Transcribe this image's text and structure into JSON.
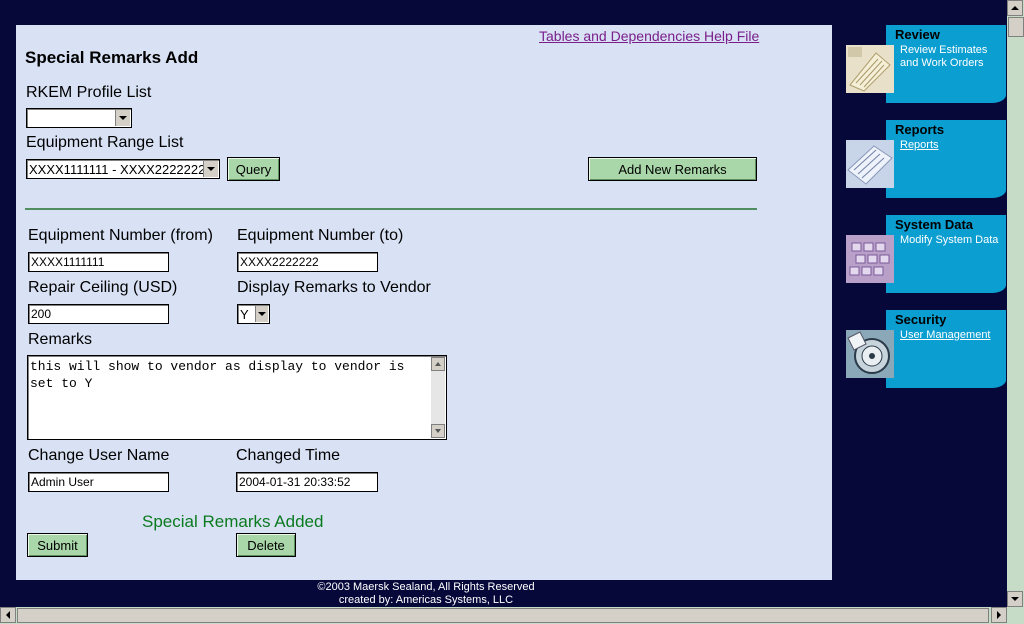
{
  "header": {
    "help_link": "Tables and Dependencies Help File",
    "page_title": "Special Remarks Add"
  },
  "filters": {
    "profile_label": "RKEM Profile List",
    "profile_value": "",
    "range_label": "Equipment Range List",
    "range_value": "XXXX1111111 - XXXX2222222",
    "query_button": "Query",
    "add_new_button": "Add New Remarks"
  },
  "form": {
    "equip_from_label": "Equipment Number (from)",
    "equip_from_value": "XXXX1111111",
    "equip_to_label": "Equipment Number (to)",
    "equip_to_value": "XXXX2222222",
    "repair_ceiling_label": "Repair Ceiling (USD)",
    "repair_ceiling_value": "200",
    "display_vendor_label": "Display Remarks to Vendor",
    "display_vendor_value": "Y",
    "remarks_label": "Remarks",
    "remarks_value": "this will show to vendor as display to vendor is set to Y",
    "change_user_label": "Change User Name",
    "change_user_value": "Admin User",
    "changed_time_label": "Changed Time",
    "changed_time_value": "2004-01-31 20:33:52",
    "status_message": "Special Remarks Added",
    "submit_button": "Submit",
    "delete_button": "Delete"
  },
  "footer": {
    "line1": "©2003 Maersk Sealand, All Rights Reserved",
    "line2": "created by: Americas Systems, LLC"
  },
  "nav": [
    {
      "title": "Review",
      "link": "Review Estimates and Work Orders",
      "icon": "documents-icon"
    },
    {
      "title": "Reports",
      "link": "Reports",
      "icon": "reports-icon"
    },
    {
      "title": "System Data",
      "link": "Modify System Data",
      "icon": "keyboard-icon"
    },
    {
      "title": "Security",
      "link": "User Management",
      "icon": "lock-icon"
    }
  ],
  "colors": {
    "page_bg": "#06083a",
    "panel_bg": "#d9e2f5",
    "button_bg": "#a9d7a9",
    "nav_accent": "#0b9ed1",
    "success": "#0a7a1f",
    "link": "#7a1f8a"
  }
}
